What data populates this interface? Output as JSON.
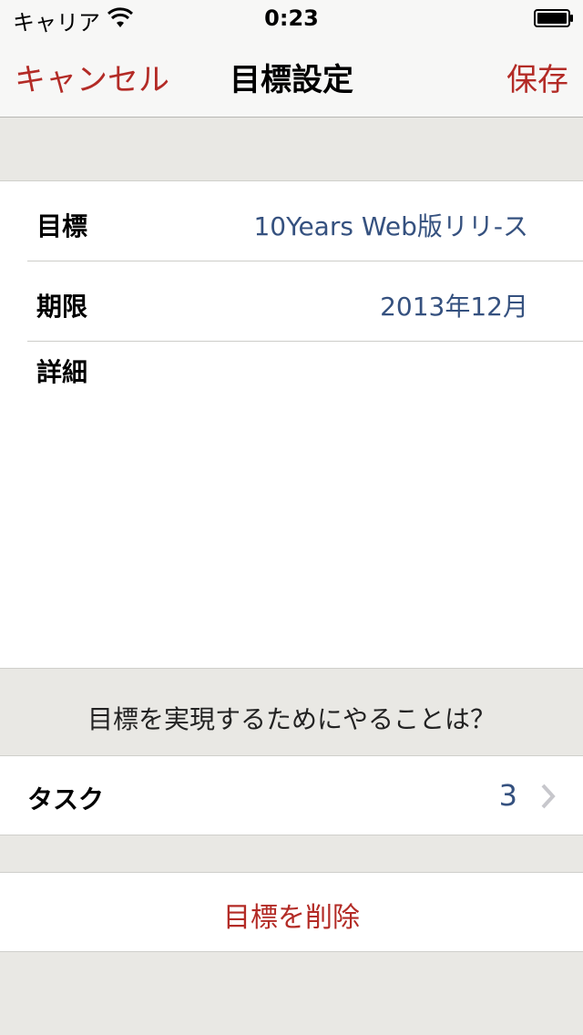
{
  "status_bar": {
    "carrier": "キャリア",
    "time": "0:23"
  },
  "nav": {
    "cancel": "キャンセル",
    "title": "目標設定",
    "save": "保存"
  },
  "form": {
    "goal_label": "目標",
    "goal_value": "10Years Web版リリ-ス",
    "deadline_label": "期限",
    "deadline_value": "2013年12月",
    "detail_label": "詳細",
    "detail_value": ""
  },
  "task_section": {
    "header": "目標を実現するためにやることは？",
    "task_label": "タスク",
    "task_count": "3"
  },
  "delete": {
    "label": "目標を削除"
  },
  "colors": {
    "accent": "#b32b26",
    "value_text": "#35517f",
    "background": "#e9e8e4"
  },
  "icons": [
    "wifi-icon",
    "battery-icon",
    "chevron-right-icon"
  ]
}
